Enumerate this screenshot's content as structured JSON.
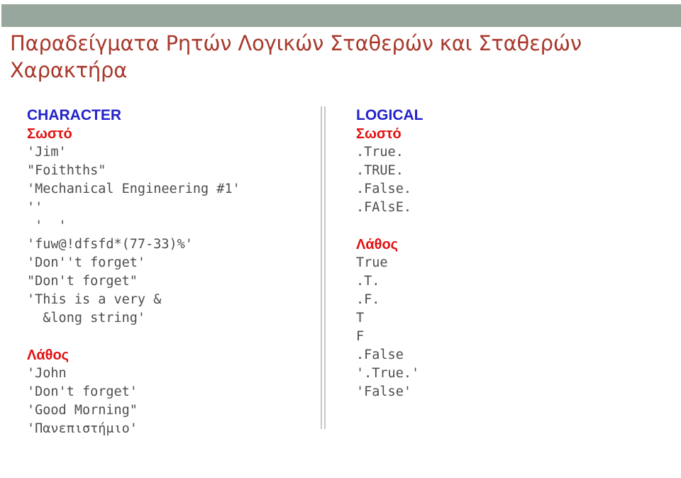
{
  "slide": {
    "title": "Παραδείγματα Ρητών Λογικών Σταθερών και Σταθερών Χαρακτήρα",
    "accent_bar_color": "#97a79e",
    "title_color": "#a8392c",
    "type_heading_color": "#2222cc",
    "group_heading_color": "#e41010",
    "code_color": "#4d4d4d"
  },
  "columns": [
    {
      "id": "character",
      "type_heading": "CHARACTER",
      "groups": [
        {
          "heading": "Σωστό",
          "lines": [
            "'Jim'",
            "\"Foithths\"",
            "'Mechanical Engineering #1'",
            "''",
            " '  '",
            "'fuw@!dfsfd*(77-33)%'",
            "'Don''t forget'",
            "\"Don't forget\"",
            "'This is a very &",
            "  &long string'"
          ]
        },
        {
          "heading": "Λάθος",
          "lines": [
            "'John",
            "'Don't forget'",
            "'Good Morning\"",
            "'Πανεπιστήμιο'"
          ]
        }
      ]
    },
    {
      "id": "logical",
      "type_heading": "LOGICAL",
      "groups": [
        {
          "heading": "Σωστό",
          "lines": [
            ".True.",
            ".TRUE.",
            ".False.",
            ".FAlsE."
          ]
        },
        {
          "heading": "Λάθος",
          "lines": [
            "True",
            ".T.",
            ".F.",
            "T",
            "F",
            ".False",
            "'.True.'",
            "'False'"
          ]
        }
      ]
    }
  ]
}
